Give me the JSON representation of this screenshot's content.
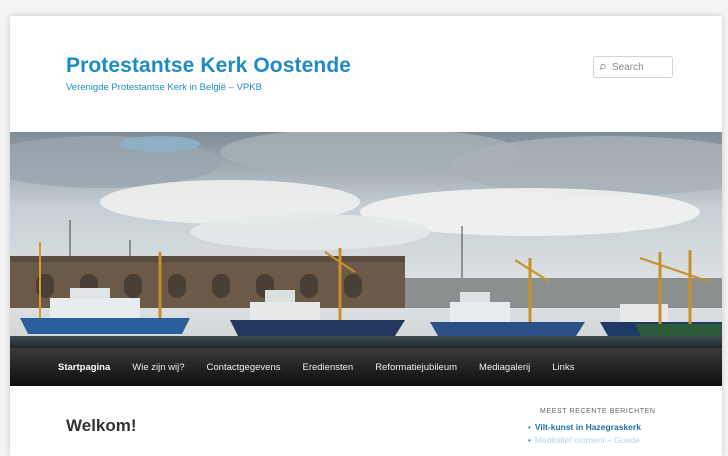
{
  "header": {
    "site_title": "Protestantse Kerk Oostende",
    "site_description": "Verenigde Protestantse Kerk in België – VPKB"
  },
  "search": {
    "placeholder": "Search",
    "icon": "search-icon"
  },
  "nav": {
    "items": [
      {
        "label": "Startpagina",
        "active": true
      },
      {
        "label": "Wie zijn wij?",
        "active": false
      },
      {
        "label": "Contactgegevens",
        "active": false
      },
      {
        "label": "Erediensten",
        "active": false
      },
      {
        "label": "Reformatiejubileum",
        "active": false
      },
      {
        "label": "Mediagalerij",
        "active": false
      },
      {
        "label": "Links",
        "active": false
      }
    ]
  },
  "main": {
    "heading": "Welkom!"
  },
  "sidebar": {
    "recent_heading": "MEEST RECENTE BERICHTEN",
    "recent_posts": [
      "Vilt-kunst in Hazegraskerk",
      "Meditatief moment – Goede"
    ]
  },
  "colors": {
    "accent": "#1e8cbe",
    "nav_bg": "#222222"
  }
}
